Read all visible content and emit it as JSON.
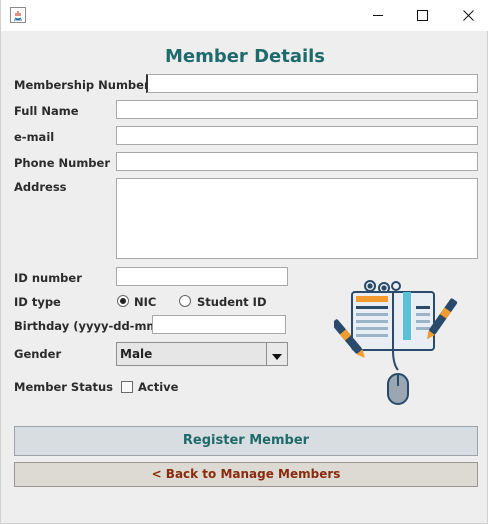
{
  "window": {
    "controls": {
      "minimize": "minimize",
      "maximize": "maximize",
      "close": "close"
    }
  },
  "form": {
    "title": "Member Details",
    "membership_number": {
      "label": "Membership Number",
      "value": ""
    },
    "full_name": {
      "label": "Full Name",
      "value": ""
    },
    "email": {
      "label": "e-mail",
      "value": ""
    },
    "phone": {
      "label": "Phone Number",
      "value": ""
    },
    "address": {
      "label": "Address",
      "value": ""
    },
    "id_number": {
      "label": "ID number",
      "value": ""
    },
    "id_type": {
      "label": "ID type",
      "options": [
        {
          "label": "NIC",
          "selected": true
        },
        {
          "label": "Student ID",
          "selected": false
        }
      ]
    },
    "birthday": {
      "label": "Birthday (yyyy-dd-mm)",
      "value": ""
    },
    "gender": {
      "label": "Gender",
      "selected": "Male"
    },
    "member_status": {
      "label": "Member Status",
      "checkbox_label": "Active",
      "checked": false
    }
  },
  "buttons": {
    "register": "Register Member",
    "back": "< Back to Manage Members"
  },
  "colors": {
    "title": "#1f6b6b",
    "register_text": "#1f6b6b",
    "back_text": "#8a2b0e",
    "illustration_accent": "#f29b2e",
    "illustration_blue": "#2a4a6b",
    "illustration_cyan": "#5bc0d8"
  }
}
